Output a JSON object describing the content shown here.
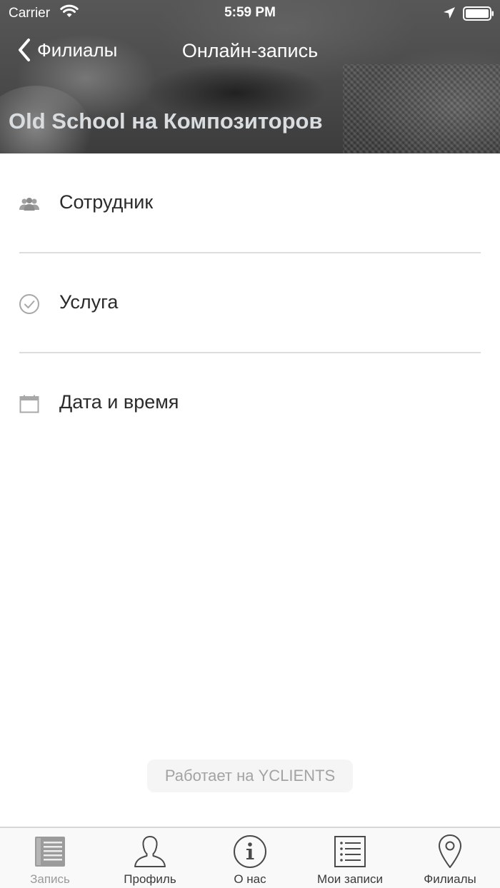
{
  "status_bar": {
    "carrier": "Carrier",
    "time": "5:59 PM",
    "icons": [
      "wifi-icon",
      "location-arrow-icon",
      "battery-icon"
    ]
  },
  "navigation": {
    "back_label": "Филиалы",
    "title": "Онлайн-запись"
  },
  "header": {
    "branch_name": "Old School на Композиторов"
  },
  "menu": {
    "items": [
      {
        "label": "Сотрудник",
        "icon": "staff-group-icon"
      },
      {
        "label": "Услуга",
        "icon": "check-circle-icon"
      },
      {
        "label": "Дата и время",
        "icon": "calendar-icon"
      }
    ]
  },
  "footer": {
    "powered_by": "Работает на YCLIENTS"
  },
  "tab_bar": {
    "tabs": [
      {
        "label": "Запись",
        "icon": "booking-list-icon",
        "active": true
      },
      {
        "label": "Профиль",
        "icon": "profile-icon",
        "active": false
      },
      {
        "label": "О нас",
        "icon": "info-icon",
        "active": false
      },
      {
        "label": "Мои записи",
        "icon": "my-records-icon",
        "active": false
      },
      {
        "label": "Филиалы",
        "icon": "map-pin-icon",
        "active": false
      }
    ]
  },
  "colors": {
    "text_primary": "#2b2b2b",
    "icon_gray": "#9a9a9a",
    "divider": "#dddddd",
    "header_text": "#d9dde0",
    "tab_active": "#9a9a9a",
    "tab_inactive": "#3a3a3a"
  }
}
